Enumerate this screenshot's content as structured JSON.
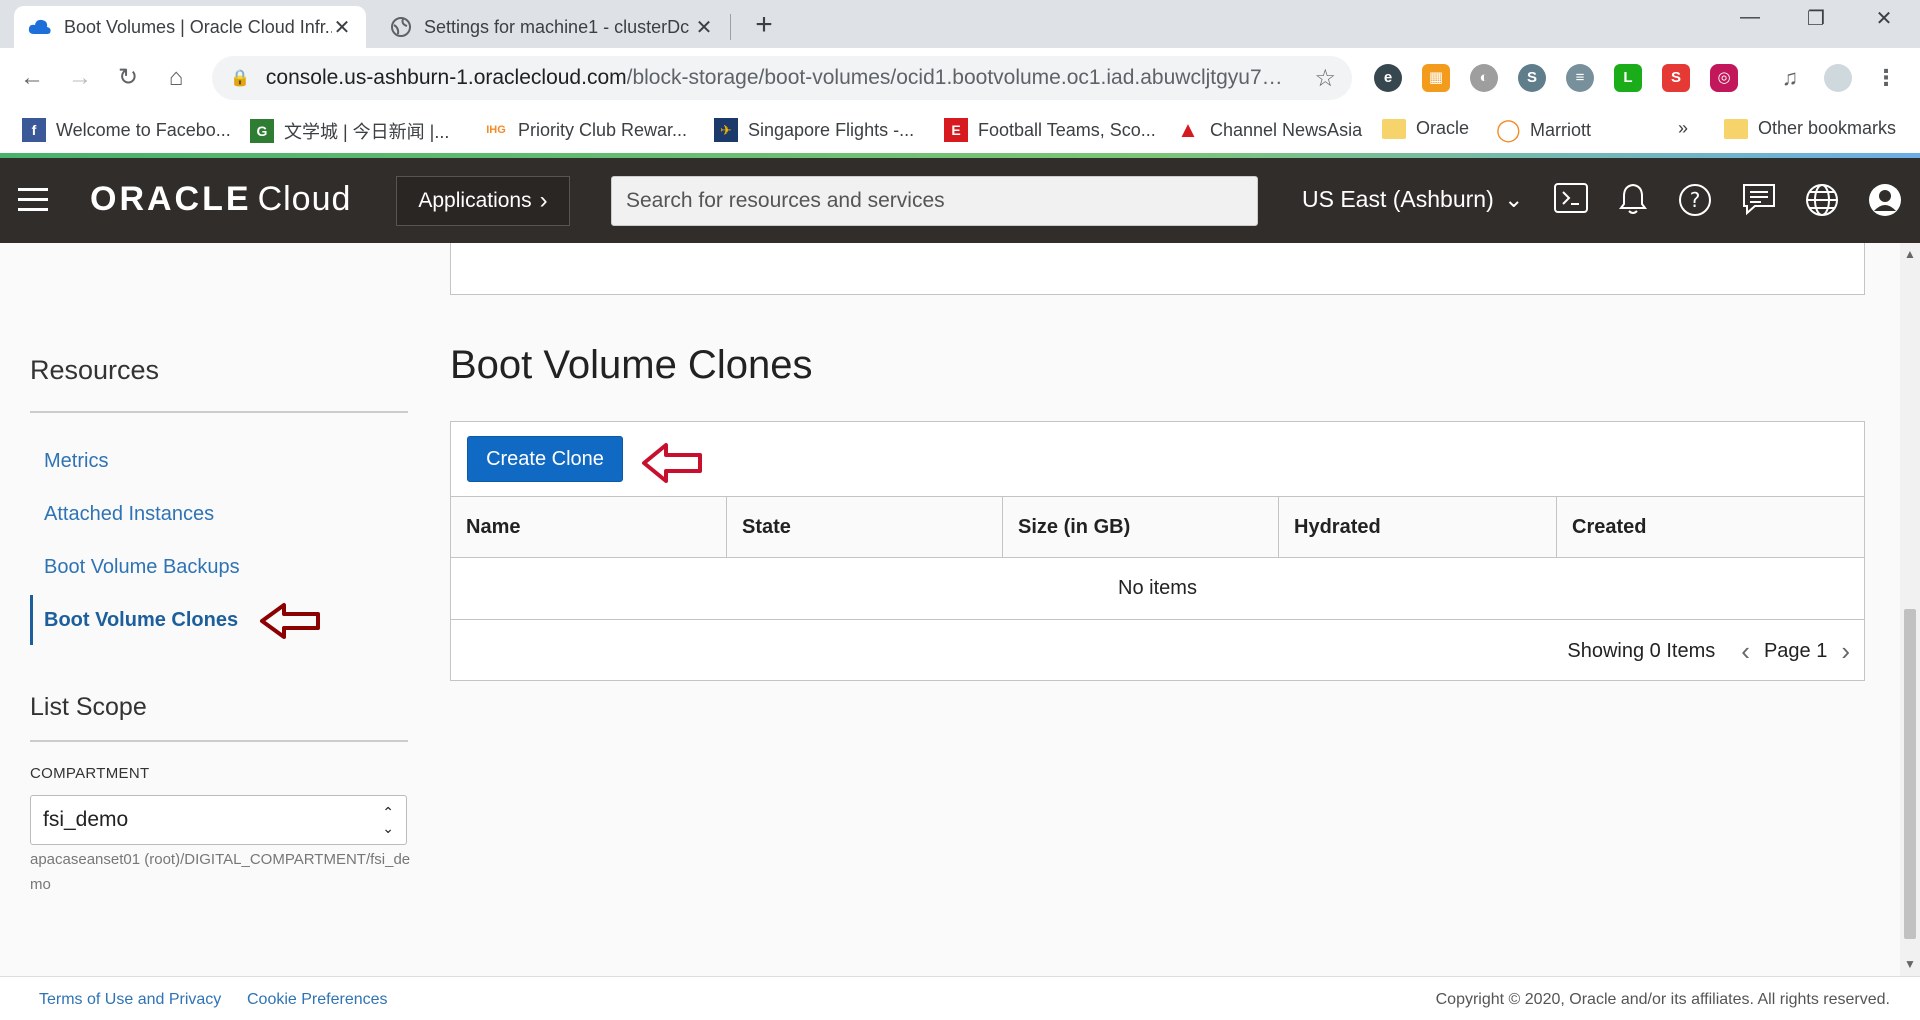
{
  "browser": {
    "tabs": [
      {
        "title": "Boot Volumes | Oracle Cloud Infr...",
        "active": true
      },
      {
        "title": "Settings for machine1 - clusterDc",
        "active": false
      }
    ],
    "url_domain": "console.us-ashburn-1.oraclecloud.com",
    "url_path": "/block-storage/boot-volumes/ocid1.bootvolume.oc1.iad.abuwcljtgyu7u...",
    "bookmarks": [
      {
        "label": "Welcome to Facebo...",
        "icon": "facebook-icon",
        "color": "#3b5998"
      },
      {
        "label": "文学城 | 今日新闻 |...",
        "icon": "wenxuecity-icon",
        "color": "#2e7d32"
      },
      {
        "label": "Priority Club Rewar...",
        "icon": "ihg-icon",
        "color": "#f28c28"
      },
      {
        "label": "Singapore Flights -...",
        "icon": "singapore-airlines-icon",
        "color": "#1b3a6b"
      },
      {
        "label": "Football Teams, Sco...",
        "icon": "espn-icon",
        "color": "#d71920"
      },
      {
        "label": "Channel NewsAsia",
        "icon": "cna-icon",
        "color": "#d71920"
      },
      {
        "label": "Oracle",
        "icon": "folder-icon",
        "color": "#f6d36b"
      },
      {
        "label": "Marriott",
        "icon": "marriott-icon",
        "color": "#f28c28"
      }
    ],
    "bookmarks_overflow": "»",
    "other_bookmarks": "Other bookmarks"
  },
  "header": {
    "logo_oracle": "ORACLE",
    "logo_cloud": "Cloud",
    "applications_label": "Applications",
    "search_placeholder": "Search for resources and services",
    "region_label": "US East (Ashburn)"
  },
  "sidebar": {
    "resources_title": "Resources",
    "links": [
      {
        "label": "Metrics",
        "active": false
      },
      {
        "label": "Attached Instances",
        "active": false
      },
      {
        "label": "Boot Volume Backups",
        "active": false
      },
      {
        "label": "Boot Volume Clones",
        "active": true
      }
    ],
    "list_scope_title": "List Scope",
    "compartment_label": "COMPARTMENT",
    "compartment_value": "fsi_demo",
    "compartment_path": "apacaseanset01 (root)/DIGITAL_COMPARTMENT/fsi_demo"
  },
  "main": {
    "title": "Boot Volume Clones",
    "create_button": "Create Clone",
    "columns": [
      "Name",
      "State",
      "Size (in GB)",
      "Hydrated",
      "Created"
    ],
    "empty_text": "No items",
    "showing_text": "Showing 0 Items",
    "page_text": "Page 1"
  },
  "footer": {
    "terms": "Terms of Use and Privacy",
    "cookies": "Cookie Preferences",
    "copyright": "Copyright © 2020, Oracle and/or its affiliates. All rights reserved."
  },
  "colors": {
    "header_bg": "#312d2a",
    "primary_button": "#1069c2",
    "link": "#2f73b5",
    "annotation_red": "#c8102e",
    "annotation_dark_red": "#8b0000"
  }
}
